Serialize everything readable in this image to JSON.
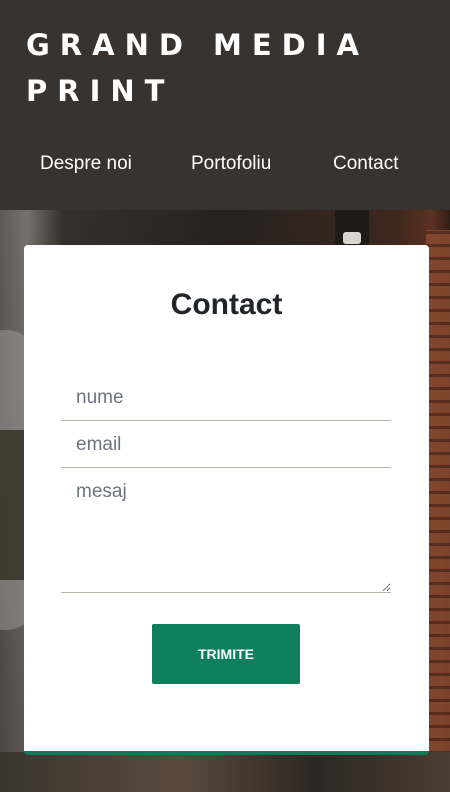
{
  "header": {
    "brand": "GRAND MEDIA PRINT",
    "nav": [
      {
        "label": "Despre noi"
      },
      {
        "label": "Portofoliu"
      },
      {
        "label": "Contact"
      }
    ]
  },
  "form": {
    "title": "Contact",
    "name_placeholder": "nume",
    "email_placeholder": "email",
    "message_placeholder": "mesaj",
    "submit_label": "TRIMITE"
  },
  "colors": {
    "header_bg": "#38332f",
    "accent": "#0e7e5c",
    "card_bg": "#ffffff"
  }
}
